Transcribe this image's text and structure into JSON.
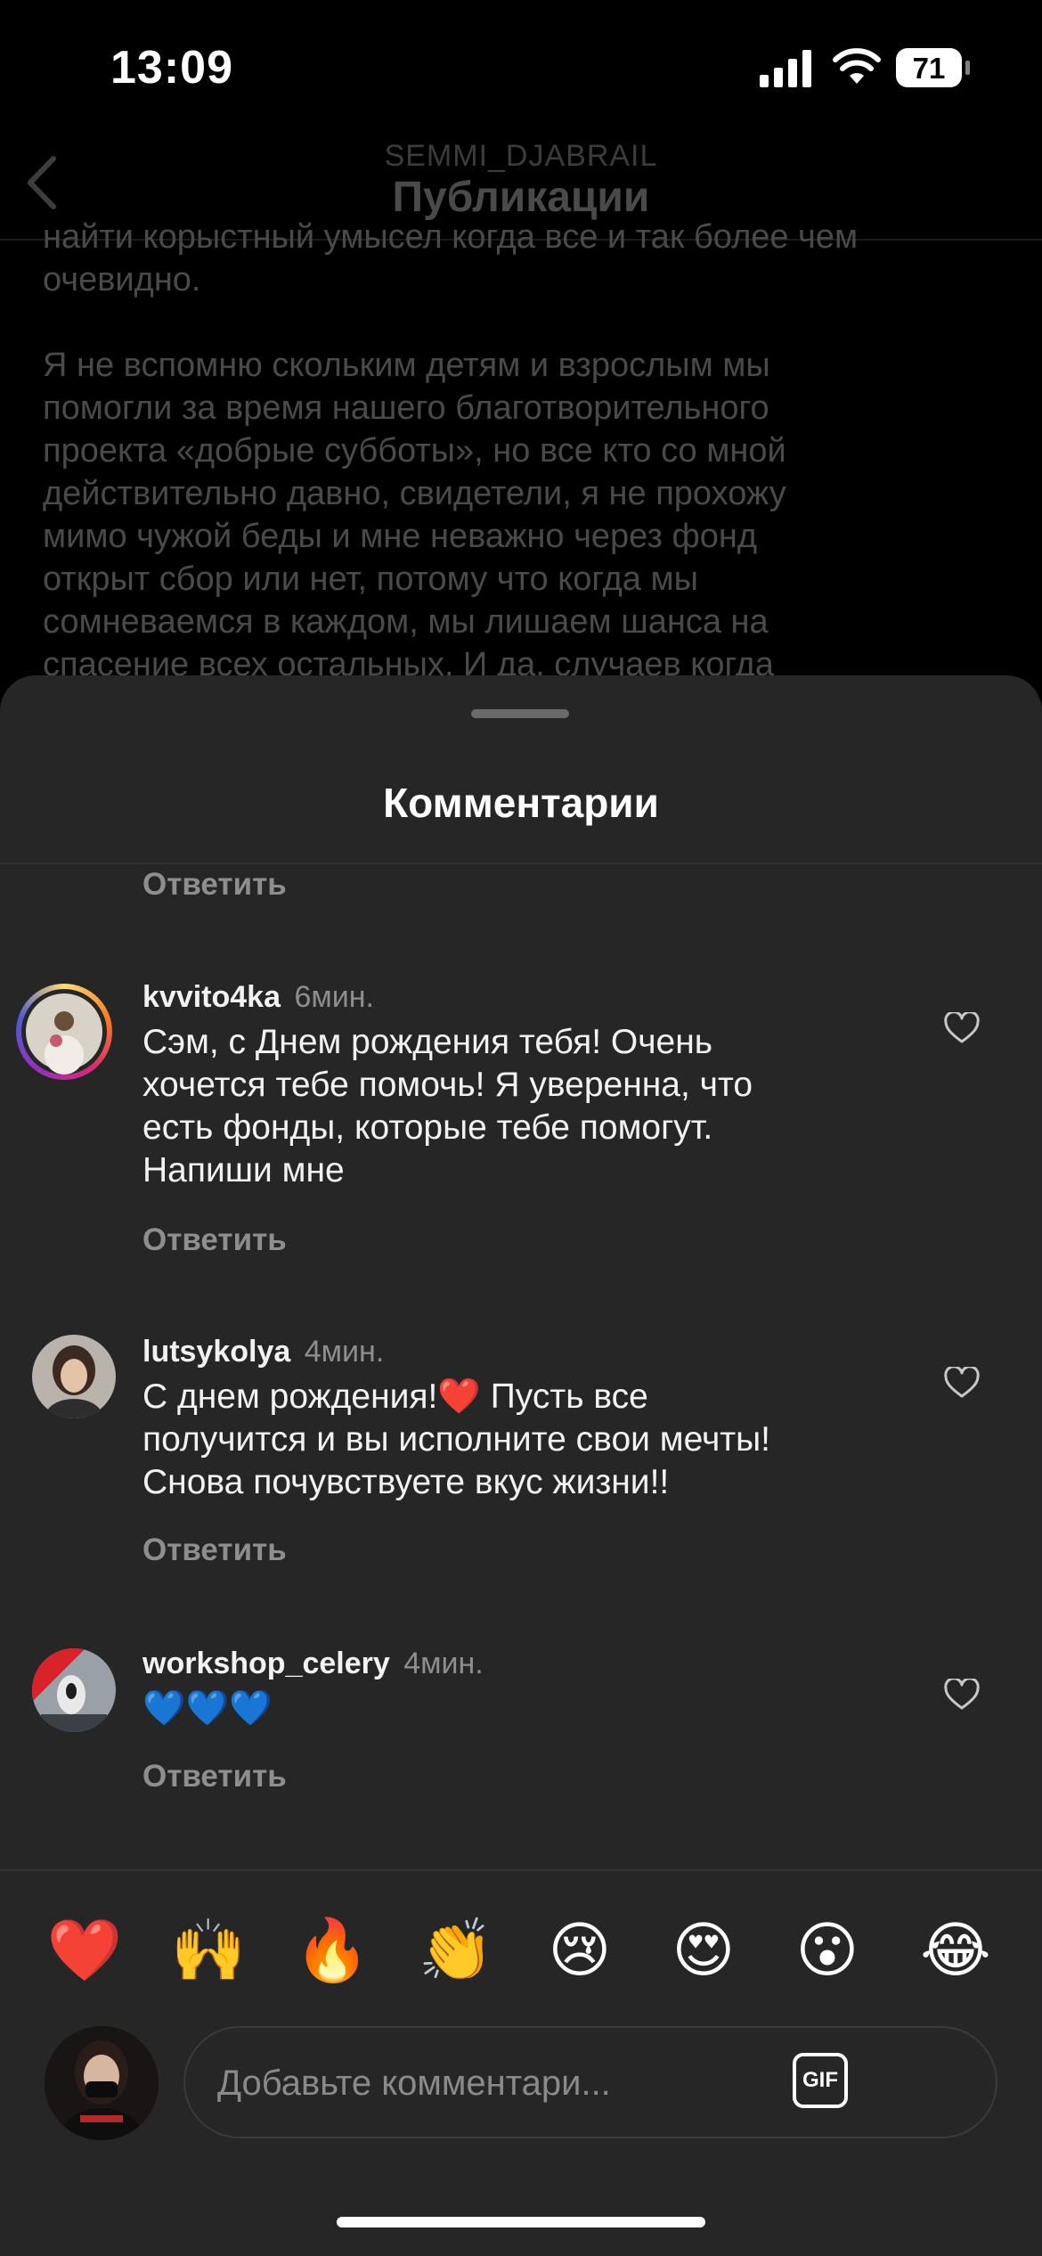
{
  "status_bar": {
    "time": "13:09",
    "battery": "71"
  },
  "header": {
    "username": "SEMMI_DJABRAIL",
    "title": "Публикации"
  },
  "post": {
    "lines_p1": [
      "найти корыстный умысел когда все и так более чем",
      "очевидно."
    ],
    "lines_p2": [
      "Я не вспомню скольким детям и взрослым мы",
      "помогли за время нашего благотворительного",
      "проекта «добрые субботы», но все кто со мной",
      "действительно давно, свидетели, я не прохожу",
      "мимо чужой беды и мне неважно через фонд",
      "открыт сбор или нет, потому что когда мы",
      "сомневаемся в каждом, мы лишаем шанса на",
      "спасение всех остальных. И да, случаев когда"
    ]
  },
  "sheet": {
    "title": "Комментарии",
    "top_reply_label": "Ответить",
    "comments": [
      {
        "username": "kvvito4ka",
        "time": "6мин.",
        "lines": [
          "Сэм, с Днем рождения тебя! Очень",
          "хочется тебе помочь! Я уверенна, что",
          "есть фонды, которые тебе помогут.",
          "Напиши мне"
        ],
        "reply_label": "Ответить"
      },
      {
        "username": "lutsykolya",
        "time": "4мин.",
        "lines": [
          "С днем рождения!❤️ Пусть все",
          "получится и вы исполните свои мечты!",
          "Снова почувствуете вкус жизни!!"
        ],
        "reply_label": "Ответить"
      },
      {
        "username": "workshop_celery",
        "time": "4мин.",
        "lines": [
          "💙💙💙"
        ],
        "reply_label": "Ответить"
      }
    ]
  },
  "quick_reactions": [
    "❤️",
    "🙌",
    "🔥",
    "👏",
    "😢",
    "😍",
    "😮",
    "😂"
  ],
  "composer": {
    "placeholder": "Добавьте комментари...",
    "gif_label": "GIF"
  }
}
